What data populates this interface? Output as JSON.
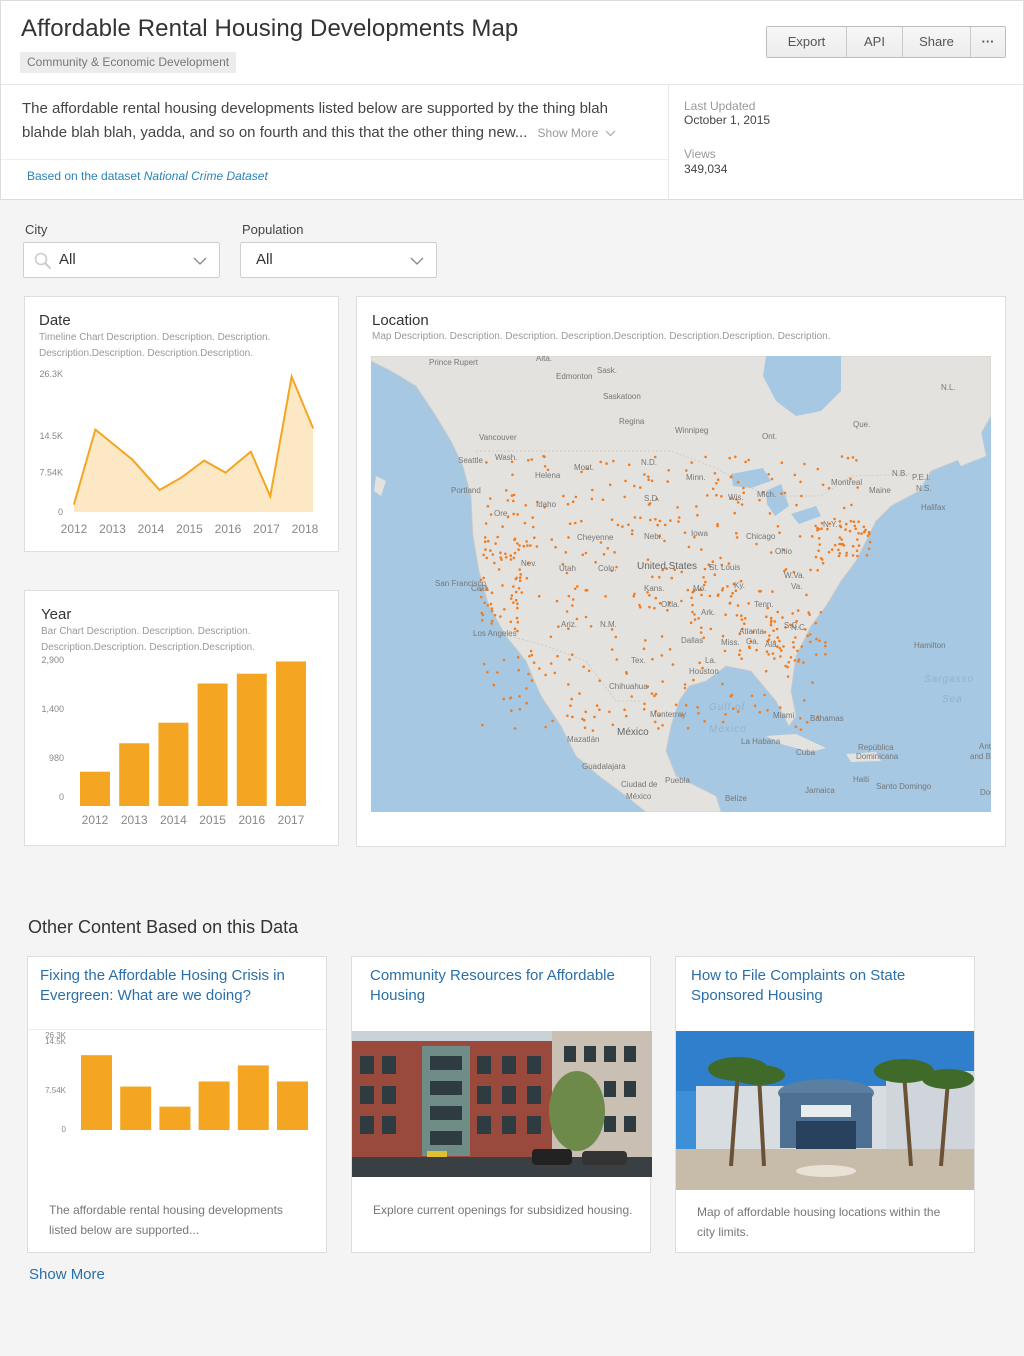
{
  "header": {
    "title": "Affordable Rental Housing Developments Map",
    "category": "Community & Economic Development",
    "actions": [
      "Export",
      "API",
      "Share",
      "···"
    ],
    "description": "The affordable rental housing developments listed below are supported by the thing blah blahde blah blah, yadda, and so on fourth and this that the other thing new...",
    "show_more": "Show More",
    "dataset_prefix": "Based on the dataset",
    "dataset_name": "National Crime Dataset",
    "last_updated_label": "Last Updated",
    "last_updated_value": "October 1, 2015",
    "views_label": "Views",
    "views_value": "349,034"
  },
  "filters": {
    "city": {
      "label": "City",
      "value": "All"
    },
    "population": {
      "label": "Population",
      "value": "All"
    }
  },
  "cards": {
    "date": {
      "title": "Date",
      "description": "Timeline Chart Description. Description. Description. Description.Description. Description.Description."
    },
    "year": {
      "title": "Year",
      "description": "Bar Chart Description. Description. Description. Description.Description. Description.Description."
    },
    "location": {
      "title": "Location",
      "description": "Map Description. Description. Description. Description.Description. Description.Description. Description."
    }
  },
  "map": {
    "labels": [
      {
        "text": "Prince Rupert"
      },
      {
        "text": "Alta."
      },
      {
        "text": "Edmonton"
      },
      {
        "text": "Sask."
      },
      {
        "text": "Saskatoon"
      },
      {
        "text": "Regina"
      },
      {
        "text": "Winnipeg"
      },
      {
        "text": "Ont."
      },
      {
        "text": "Que."
      },
      {
        "text": "N.L."
      },
      {
        "text": "Vancouver"
      },
      {
        "text": "Seattle"
      },
      {
        "text": "Wash."
      },
      {
        "text": "Mont."
      },
      {
        "text": "Helena"
      },
      {
        "text": "N.D."
      },
      {
        "text": "Minn."
      },
      {
        "text": "Portland"
      },
      {
        "text": "Ore."
      },
      {
        "text": "Idaho"
      },
      {
        "text": "S.D."
      },
      {
        "text": "Wis."
      },
      {
        "text": "Mich."
      },
      {
        "text": "Montreal"
      },
      {
        "text": "Maine"
      },
      {
        "text": "N.B."
      },
      {
        "text": "P.E.I."
      },
      {
        "text": "N.S."
      },
      {
        "text": "Halifax"
      },
      {
        "text": "Chicago"
      },
      {
        "text": "Cheyenne"
      },
      {
        "text": "Nebr."
      },
      {
        "text": "Iowa"
      },
      {
        "text": "Ohio"
      },
      {
        "text": "N.Y."
      },
      {
        "text": "Nev."
      },
      {
        "text": "Utah"
      },
      {
        "text": "Colo."
      },
      {
        "text": "United States",
        "big": true
      },
      {
        "text": "St. Louis"
      },
      {
        "text": "W.Va."
      },
      {
        "text": "San Francisco"
      },
      {
        "text": "Calif."
      },
      {
        "text": "Kans."
      },
      {
        "text": "Mo."
      },
      {
        "text": "Ky."
      },
      {
        "text": "Va."
      },
      {
        "text": "Tenn."
      },
      {
        "text": "Okla."
      },
      {
        "text": "Ark."
      },
      {
        "text": "N.C."
      },
      {
        "text": "Los Angeles"
      },
      {
        "text": "Ariz."
      },
      {
        "text": "N.M."
      },
      {
        "text": "Atlanta"
      },
      {
        "text": "S.C."
      },
      {
        "text": "Dallas"
      },
      {
        "text": "Miss."
      },
      {
        "text": "Ala."
      },
      {
        "text": "Ga."
      },
      {
        "text": "Tex."
      },
      {
        "text": "La."
      },
      {
        "text": "Hamilton"
      },
      {
        "text": "Houston"
      },
      {
        "text": "Chihuahua"
      },
      {
        "text": "Sargasso",
        "sea": true
      },
      {
        "text": "Sea",
        "sea": true
      },
      {
        "text": "Gulf of",
        "sea": true
      },
      {
        "text": "Mexico",
        "sea": true
      },
      {
        "text": "Miami"
      },
      {
        "text": "Bahamas"
      },
      {
        "text": "Monterrey"
      },
      {
        "text": "México",
        "big": true
      },
      {
        "text": "Mazatlán"
      },
      {
        "text": "La Habana"
      },
      {
        "text": "Cuba"
      },
      {
        "text": "República"
      },
      {
        "text": "Dominicana"
      },
      {
        "text": "Antig"
      },
      {
        "text": "and Ba"
      },
      {
        "text": "Guadalajara"
      },
      {
        "text": "Puebla"
      },
      {
        "text": "Haiti"
      },
      {
        "text": "Santo Domingo"
      },
      {
        "text": "Jamaica"
      },
      {
        "text": "Ciudad de"
      },
      {
        "text": "México"
      },
      {
        "text": "Belize"
      },
      {
        "text": "Domi"
      }
    ]
  },
  "section_title": "Other Content Based on this Data",
  "related": [
    {
      "title": "Fixing the Affordable Hosing Crisis in Evergreen: What are we doing?",
      "body": "The affordable rental housing developments listed below are supported..."
    },
    {
      "title": "Community Resources for Affordable Housing",
      "body": "Explore current openings for subsidized housing."
    },
    {
      "title": "How to File Complaints on State Sponsored Housing",
      "body": "Map of affordable housing locations within the city limits."
    }
  ],
  "show_more_link": "Show More",
  "colors": {
    "accent": "#f4a623",
    "area_fill": "#fde8c6",
    "link": "#2a6fa8",
    "map_water": "#a6c8e2",
    "map_land": "#e4e2de",
    "map_dot": "#f07c21"
  },
  "chart_data": [
    {
      "type": "area",
      "title": "Date",
      "x": [
        2012,
        2012.55,
        2013.5,
        2014.2,
        2014.75,
        2015.35,
        2015.9,
        2016.55,
        2017.05,
        2017.6,
        2018.15
      ],
      "values": [
        1500,
        15700,
        10000,
        4200,
        6500,
        9800,
        7500,
        11500,
        3000,
        25800,
        16000
      ],
      "xticks": [
        "2012",
        "2013",
        "2014",
        "2015",
        "2016",
        "2017",
        "2018"
      ],
      "yticks": [
        "0",
        "7.54K",
        "14.5K",
        "26.3K"
      ],
      "ylim": [
        0,
        26300
      ]
    },
    {
      "type": "bar",
      "title": "Year",
      "categories": [
        "2012",
        "2013",
        "2014",
        "2015",
        "2016",
        "2017"
      ],
      "values": [
        700,
        1280,
        1700,
        2500,
        2700,
        2950
      ],
      "yticks": [
        "0",
        "980",
        "1,400",
        "2,900"
      ],
      "ylim": [
        0,
        3000
      ]
    },
    {
      "type": "bar",
      "title": "Fixing the Affordable Hosing Crisis in Evergreen: What are we doing?",
      "categories": [
        "",
        "",
        "",
        "",
        "",
        ""
      ],
      "values": [
        20500,
        11900,
        6400,
        13300,
        17700,
        13300
      ],
      "yticks": [
        "0",
        "7.54K",
        "14.5K",
        "26.3K"
      ],
      "ylim": [
        0,
        26300
      ]
    }
  ]
}
